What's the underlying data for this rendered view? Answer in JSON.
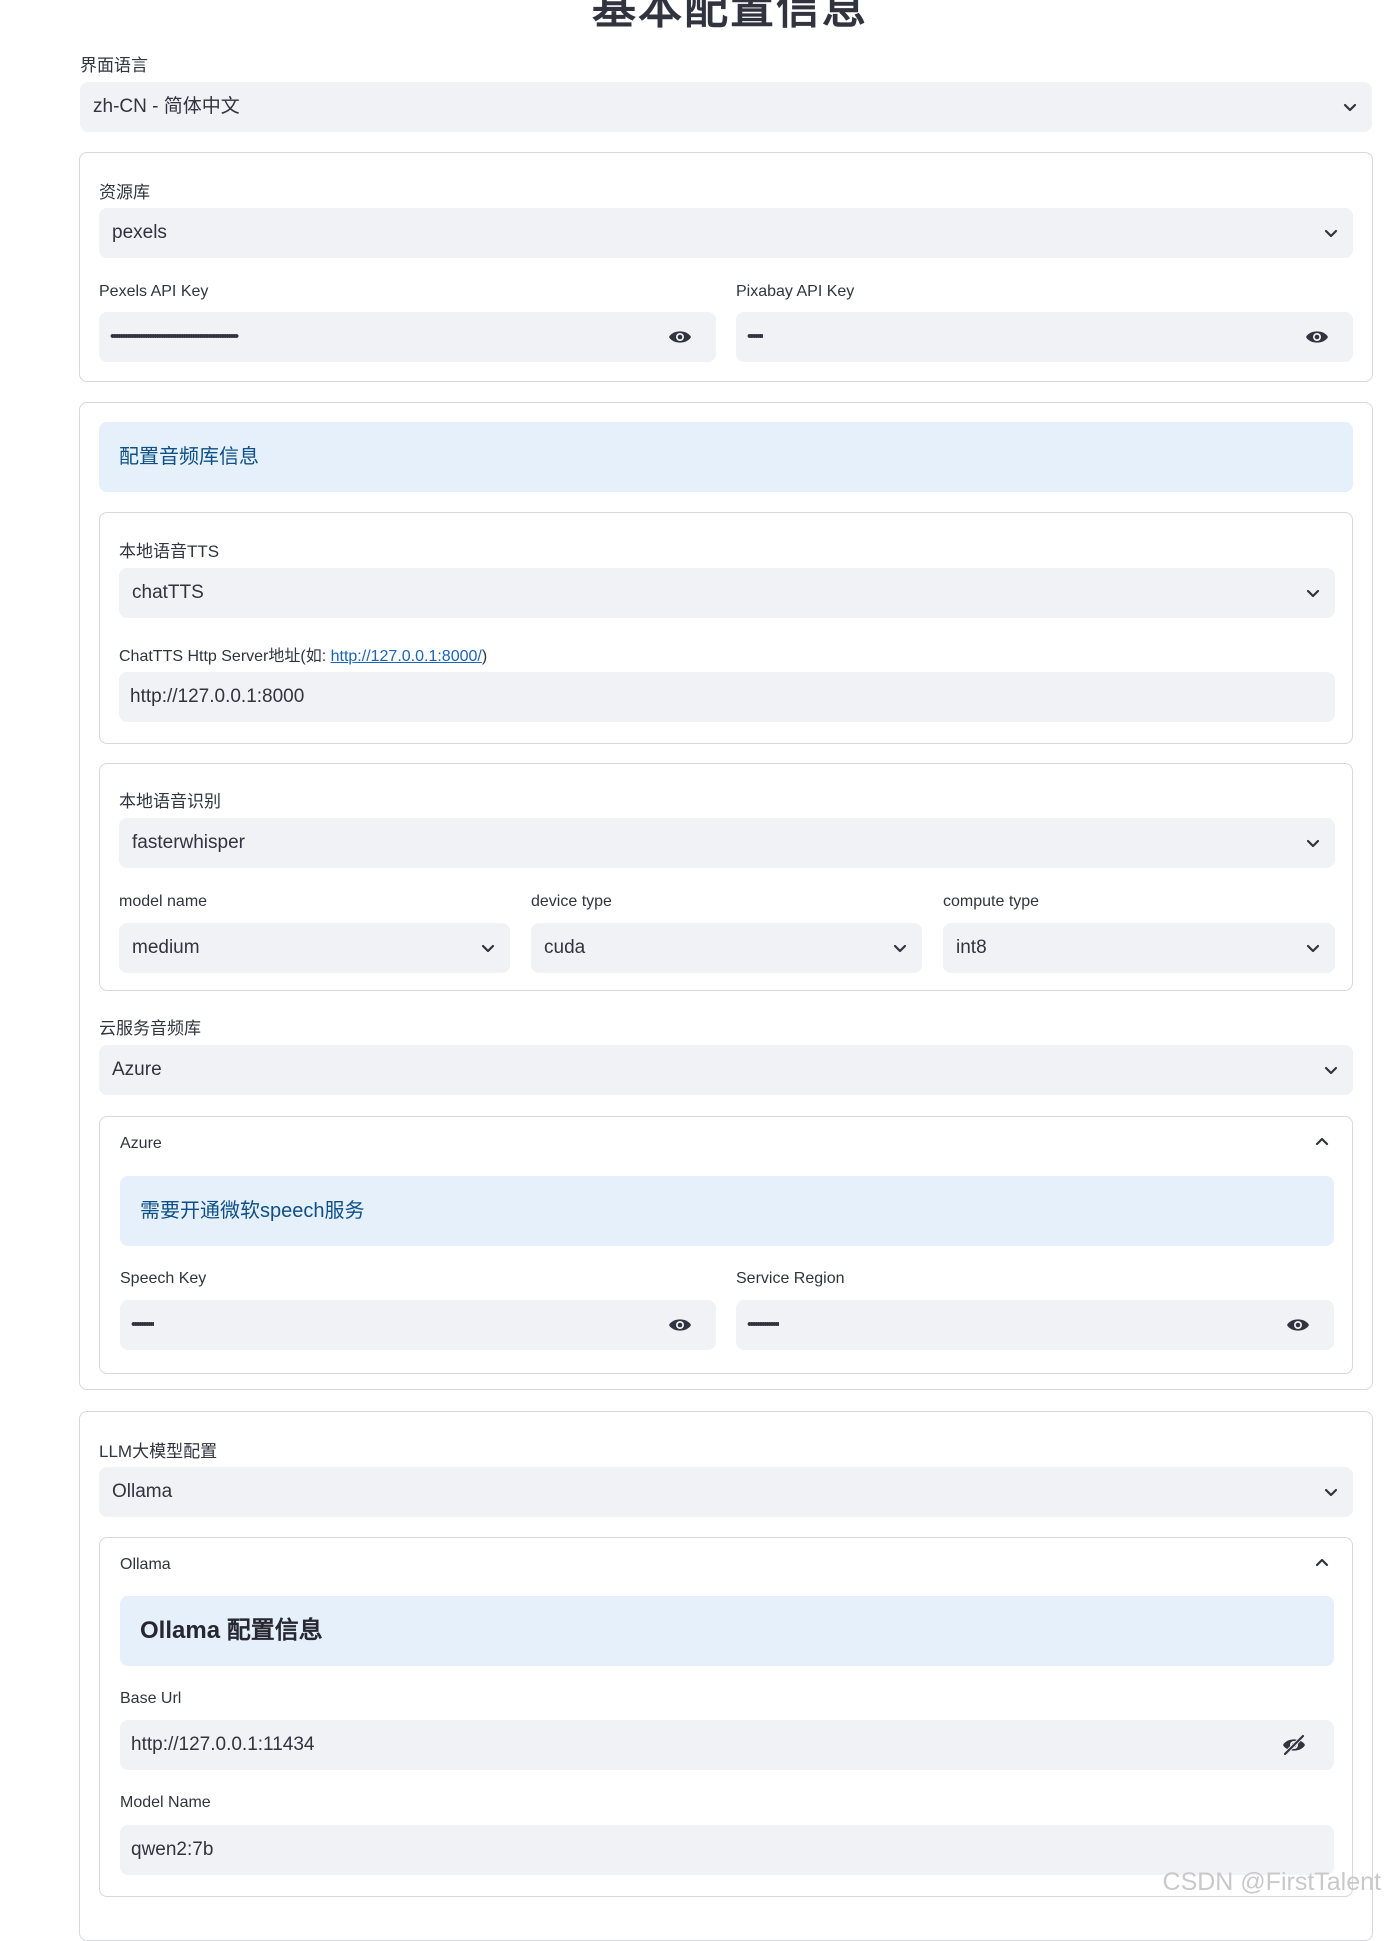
{
  "page": {
    "title_partial": "基本配置信息"
  },
  "language": {
    "label": "界面语言",
    "value": "zh-CN - 简体中文"
  },
  "resource": {
    "label": "资源库",
    "value": "pexels",
    "pexels_key": {
      "label": "Pexels API Key",
      "masked": "••••••••••••••••••••••••••••••••••••••••••••••••••••••••"
    },
    "pixabay_key": {
      "label": "Pixabay API Key",
      "masked": "•••••••"
    }
  },
  "audio": {
    "info": "配置音频库信息",
    "tts": {
      "label": "本地语音TTS",
      "value": "chatTTS",
      "server_label_prefix": "ChatTTS Http Server地址(如: ",
      "server_label_link": "http://127.0.0.1:8000/",
      "server_label_suffix": ")",
      "server_value": "http://127.0.0.1:8000"
    },
    "asr": {
      "label": "本地语音识别",
      "value": "fasterwhisper",
      "model_name": {
        "label": "model name",
        "value": "medium"
      },
      "device_type": {
        "label": "device type",
        "value": "cuda"
      },
      "compute_type": {
        "label": "compute type",
        "value": "int8"
      }
    },
    "cloud": {
      "label": "云服务音频库",
      "value": "Azure",
      "expander_title": "Azure",
      "info": "需要开通微软speech服务",
      "speech_key": {
        "label": "Speech Key",
        "masked": "••••••••••"
      },
      "service_region": {
        "label": "Service Region",
        "masked": "••••••••••••••"
      }
    }
  },
  "llm": {
    "label": "LLM大模型配置",
    "value": "Ollama",
    "expander_title": "Ollama",
    "info": "Ollama 配置信息",
    "base_url": {
      "label": "Base Url",
      "value": "http://127.0.0.1:11434"
    },
    "model_name": {
      "label": "Model Name",
      "value": "qwen2:7b"
    }
  },
  "watermark": "CSDN @FirstTalent",
  "colors": {
    "field_bg": "#f0f2f6",
    "info_bg": "#e6f0fb",
    "info_text": "#0d4f86",
    "border": "#d6d8de"
  }
}
